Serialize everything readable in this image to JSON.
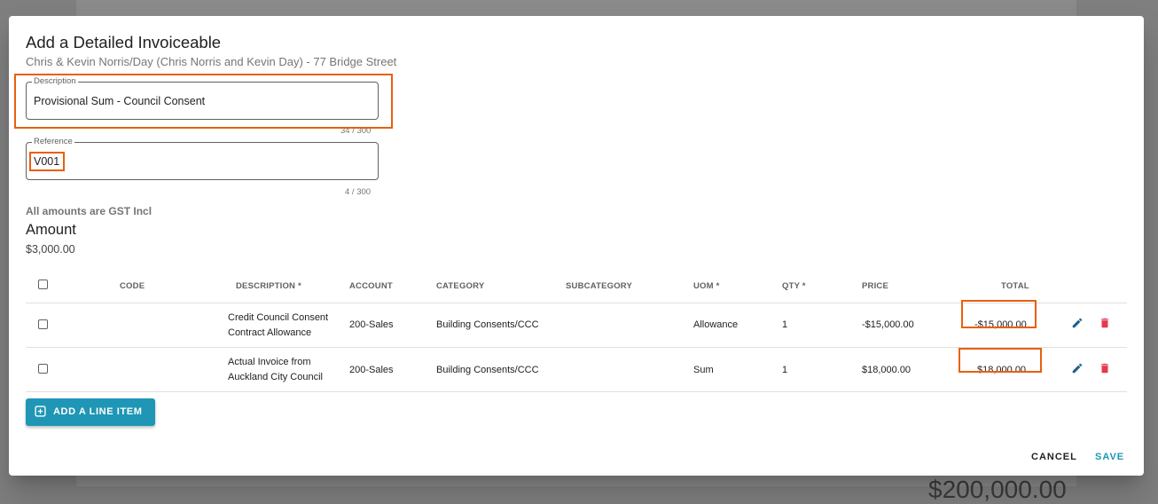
{
  "backdrop": {
    "amount_text": "$200,000.00"
  },
  "dialog": {
    "title": "Add a Detailed Invoiceable",
    "subtitle": "Chris & Kevin Norris/Day (Chris Norris and Kevin Day) - 77 Bridge Street"
  },
  "description_field": {
    "label": "Description",
    "value": "Provisional Sum - Council Consent",
    "counter": "34 / 300"
  },
  "reference_field": {
    "label": "Reference",
    "value": "V001",
    "counter": "4 / 300"
  },
  "gst_note": "All amounts are GST Incl",
  "amount": {
    "heading": "Amount",
    "value": "$3,000.00"
  },
  "table": {
    "headers": {
      "code": "CODE",
      "description": "DESCRIPTION *",
      "account": "ACCOUNT",
      "category": "CATEGORY",
      "subcategory": "SUBCATEGORY",
      "uom": "UOM *",
      "qty": "QTY *",
      "price": "PRICE",
      "total": "TOTAL"
    },
    "rows": [
      {
        "code": "",
        "description_line1": "Credit Council Consent",
        "description_line2": "Contract Allowance",
        "account": "200-Sales",
        "category": "Building Consents/CCC",
        "subcategory": "",
        "uom": "Allowance",
        "qty": "1",
        "price": "-$15,000.00",
        "total": "-$15,000.00"
      },
      {
        "code": "",
        "description_line1": "Actual Invoice from",
        "description_line2": "Auckland City Council",
        "account": "200-Sales",
        "category": "Building Consents/CCC",
        "subcategory": "",
        "uom": "Sum",
        "qty": "1",
        "price": "$18,000.00",
        "total": "$18,000.00"
      }
    ]
  },
  "buttons": {
    "add_line_item": "ADD A LINE ITEM",
    "cancel": "CANCEL",
    "save": "SAVE"
  },
  "colors": {
    "accent": "#1f96b5",
    "delete": "#e53950",
    "edit": "#1c5f8a",
    "highlight": "#e8600c"
  },
  "icons": {
    "edit": "pencil-icon",
    "delete": "trash-icon",
    "add": "plus-box-icon"
  }
}
